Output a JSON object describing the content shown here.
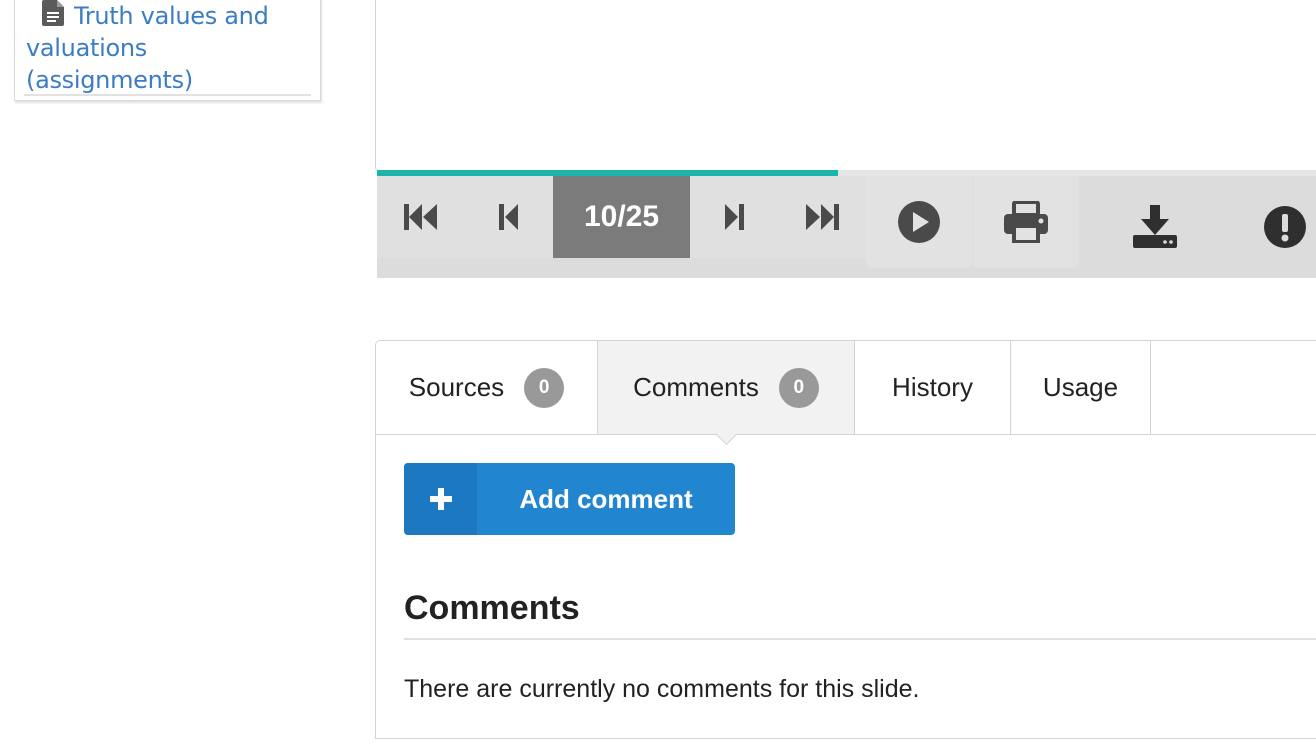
{
  "nav": {
    "doc_link": "Truth values and valuations (assignments)",
    "doc_icon": "document-icon"
  },
  "slide": {
    "progress_fraction": 0.491,
    "progress_color": "#1ab4a9"
  },
  "toolbar": {
    "counter": "10/25",
    "icons": [
      "first-slide-icon",
      "previous-slide-icon",
      "next-slide-icon",
      "last-slide-icon",
      "play-icon",
      "print-icon",
      "download-icon",
      "report-icon"
    ]
  },
  "tabs": [
    {
      "label": "Sources",
      "badge": "0"
    },
    {
      "label": "Comments",
      "badge": "0",
      "active": true
    },
    {
      "label": "History"
    },
    {
      "label": "Usage"
    }
  ],
  "comments": {
    "add_button_label": "Add comment",
    "add_button_icon": "plus-icon",
    "heading": "Comments",
    "empty_message": "There are currently no comments for this slide.",
    "accent_color": "#2185d0"
  }
}
